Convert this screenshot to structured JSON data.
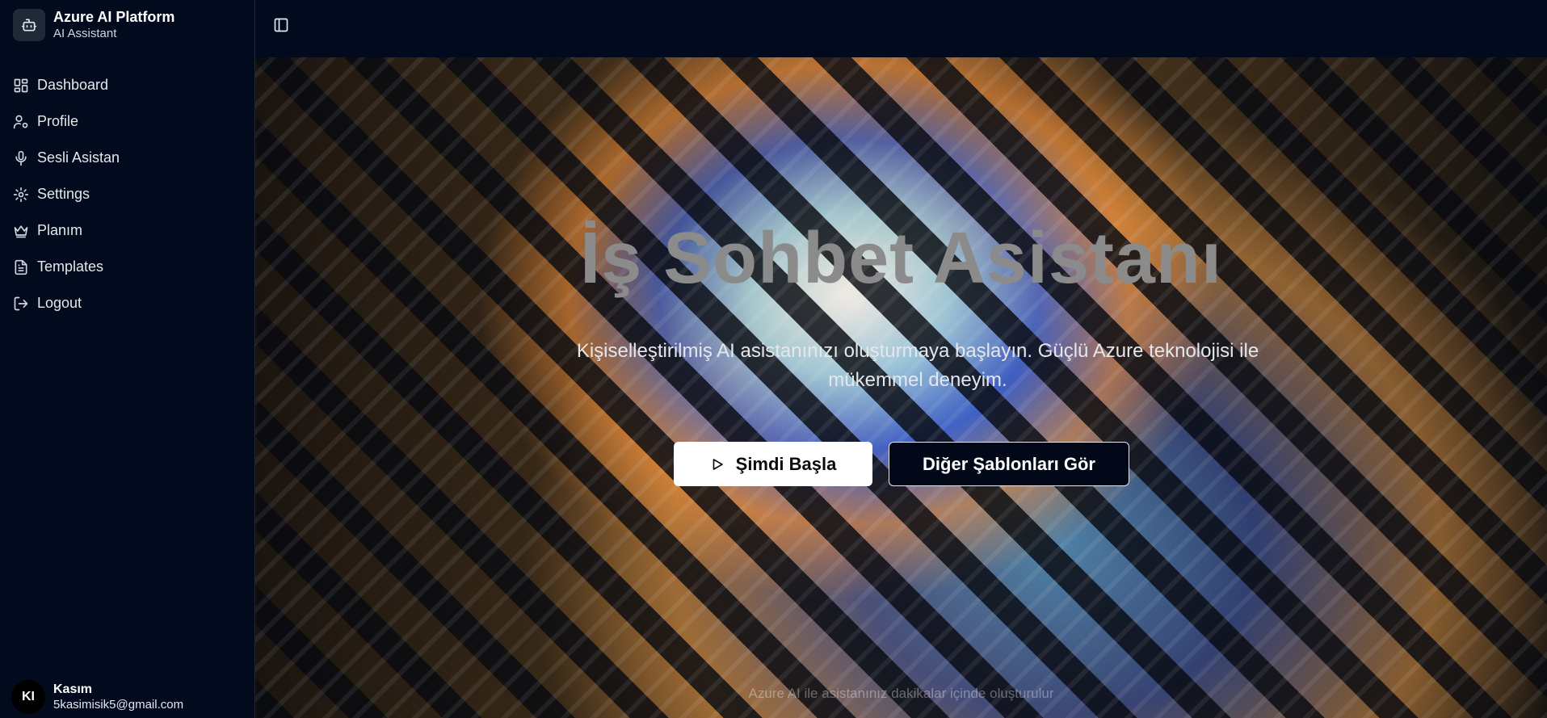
{
  "brand": {
    "title": "Azure AI Platform",
    "subtitle": "AI Assistant",
    "icon": "bot-icon"
  },
  "sidebar": {
    "items": [
      {
        "label": "Dashboard",
        "icon": "dashboard-icon"
      },
      {
        "label": "Profile",
        "icon": "user-cog-icon"
      },
      {
        "label": "Sesli Asistan",
        "icon": "microphone-icon"
      },
      {
        "label": "Settings",
        "icon": "gear-icon"
      },
      {
        "label": "Planım",
        "icon": "crown-icon"
      },
      {
        "label": "Templates",
        "icon": "document-icon"
      },
      {
        "label": "Logout",
        "icon": "logout-icon"
      }
    ]
  },
  "user": {
    "initials": "KI",
    "name": "Kasım",
    "email": "5kasimisik5@gmail.com"
  },
  "hero": {
    "title": "İş Sohbet Asistanı",
    "description": "Kişiselleştirilmiş AI asistanınızı oluşturmaya başlayın. Güçlü Azure teknolojisi ile mükemmel deneyim.",
    "primary_button": "Şimdi Başla",
    "secondary_button": "Diğer Şablonları Gör",
    "footer": "Azure AI ile asistanınız dakikalar içinde oluşturulur"
  },
  "colors": {
    "background": "#020817",
    "sidebar": "#020a1e",
    "button_primary": "#ffffff"
  }
}
